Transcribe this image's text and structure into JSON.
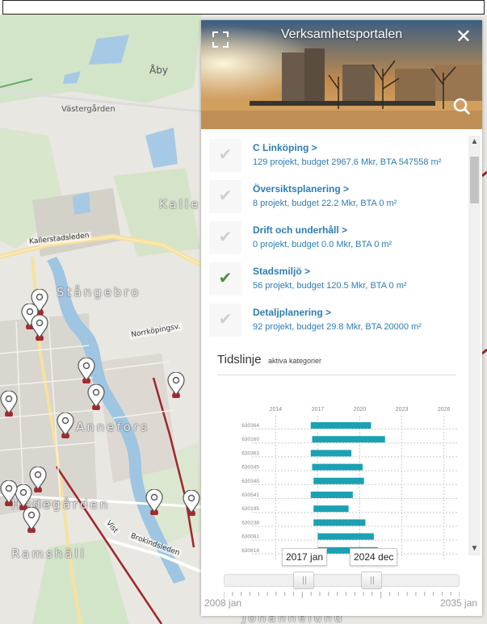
{
  "map": {
    "labels": [
      "Åby",
      "Västergården",
      "Kalle",
      "Kallerstadsleden",
      "Stångebro",
      "Norrköpingsv.",
      "Annefors",
      "Hedegården",
      "Ramshäll",
      "Brokindsleden",
      "Vist",
      "Johannelund"
    ]
  },
  "panel": {
    "title": "Verksamhetsportalen",
    "close_glyph": "✕"
  },
  "categories": [
    {
      "name": "C Linköping >",
      "summary": "129 projekt, budget 2967.6 Mkr, BTA 547558 m²",
      "checked": false
    },
    {
      "name": "Översiktsplanering >",
      "summary": "8 projekt, budget 22.2 Mkr, BTA 0 m²",
      "checked": false
    },
    {
      "name": "Drift och underhåll >",
      "summary": "0 projekt, budget 0.0 Mkr, BTA 0 m²",
      "checked": false
    },
    {
      "name": "Stadsmiljö >",
      "summary": "56 projekt, budget 120.5 Mkr, BTA 0 m²",
      "checked": true
    },
    {
      "name": "Detaljplanering >",
      "summary": "92 projekt, budget 29.8 Mkr, BTA 20000 m²",
      "checked": false
    }
  ],
  "timeline": {
    "title": "Tidslinje",
    "subtitle": "aktiva kategorier",
    "range_start": "2017 jan",
    "range_end": "2024 dec",
    "axis_start": "2008 jan",
    "axis_end": "2035 jan"
  },
  "chart_data": {
    "type": "bar",
    "orientation": "horizontal",
    "x_ticks": [
      2014,
      2017,
      2020,
      2023,
      2026
    ],
    "x_tick_labels": [
      "2014",
      "2017",
      "2020",
      "2023",
      "2026"
    ],
    "xlim": [
      2013,
      2027
    ],
    "grid": true,
    "series": [
      {
        "color": "#1ba1b2",
        "values": [
          {
            "label": "630364",
            "start": 2016.5,
            "end": 2020.8
          },
          {
            "label": "630160",
            "start": 2016.6,
            "end": 2021.8
          },
          {
            "label": "630363",
            "start": 2016.5,
            "end": 2019.4
          },
          {
            "label": "630345",
            "start": 2016.6,
            "end": 2020.2
          },
          {
            "label": "630345",
            "start": 2016.7,
            "end": 2020.3
          },
          {
            "label": "630541",
            "start": 2016.5,
            "end": 2019.5
          },
          {
            "label": "630195",
            "start": 2016.7,
            "end": 2019.2
          },
          {
            "label": "630238",
            "start": 2016.7,
            "end": 2020.4
          },
          {
            "label": "630081",
            "start": 2017.0,
            "end": 2021.0
          },
          {
            "label": "630818",
            "start": 2017.0,
            "end": 2021.3
          }
        ]
      }
    ]
  }
}
